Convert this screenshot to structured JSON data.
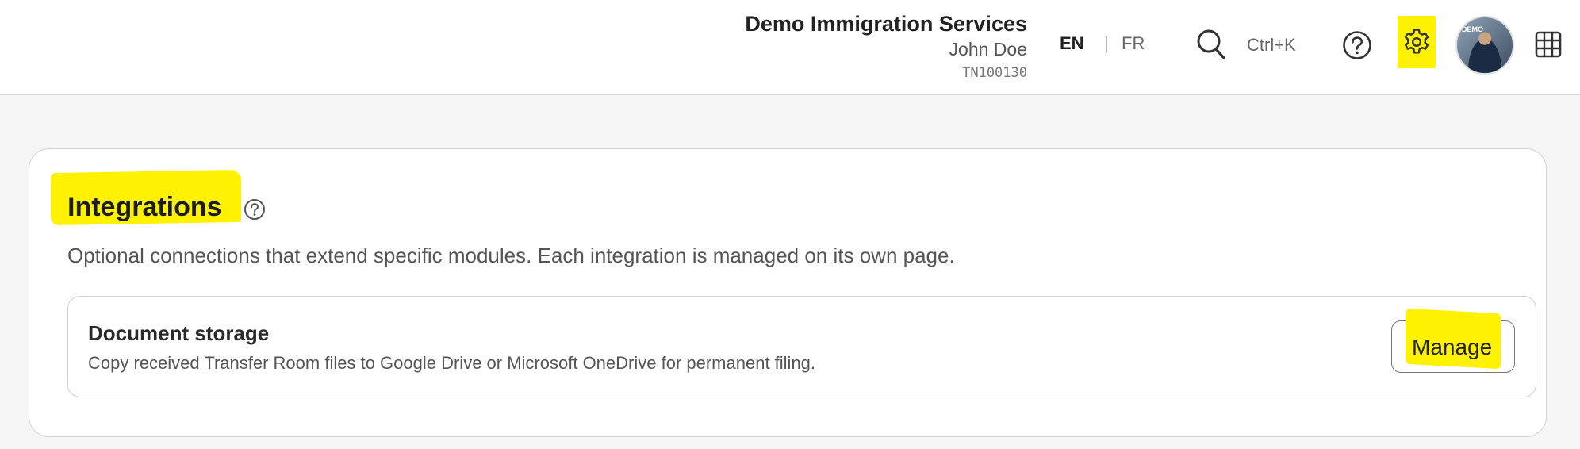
{
  "header": {
    "org_name": "Demo Immigration Services",
    "user_name": "John Doe",
    "user_code": "TN100130",
    "lang_en": "EN",
    "lang_sep": "|",
    "lang_fr": "FR",
    "search_shortcut": "Ctrl+K",
    "avatar_badge": "DEMO",
    "highlight_color": "#fff200"
  },
  "integrations": {
    "title": "Integrations",
    "description": "Optional connections that extend specific modules. Each integration is managed on its own page.",
    "items": [
      {
        "title": "Document storage",
        "description": "Copy received Transfer Room files to Google Drive or Microsoft OneDrive for permanent filing.",
        "button_label": "Manage"
      }
    ]
  }
}
